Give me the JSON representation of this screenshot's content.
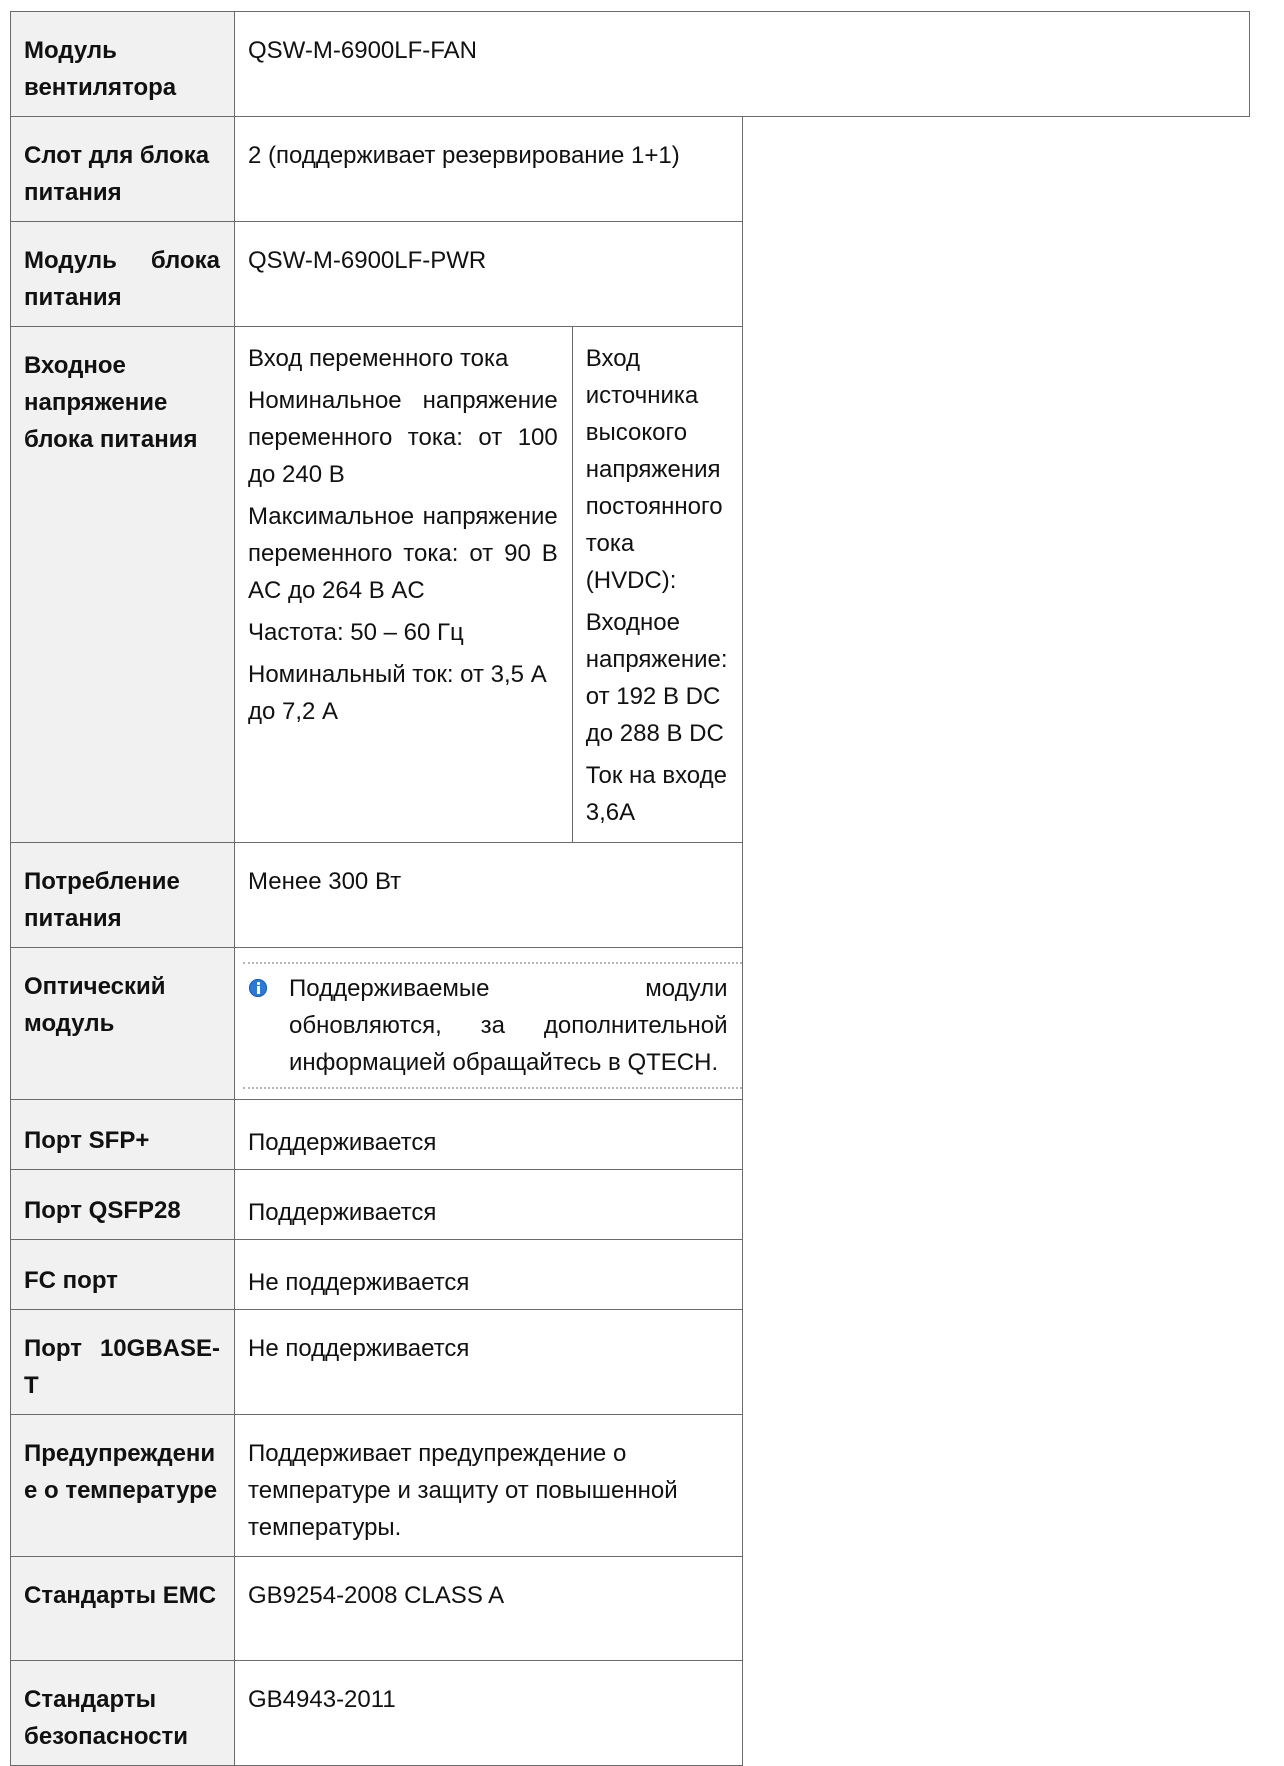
{
  "rows": [
    {
      "label": "Модуль вентилятора",
      "value": "QSW-M-6900LF-FAN"
    },
    {
      "label": "Слот для блока питания",
      "value": "2 (поддерживает резервирование 1+1)"
    },
    {
      "label": "Модуль блока питания",
      "value": "QSW-M-6900LF-PWR"
    },
    {
      "label": "Входное напряжение блока питания",
      "ac": [
        "Вход переменного тока",
        "Номинальное напряжение переменного тока: от 100 до 240 В",
        "Максимальное напряжение переменного тока: от 90 В AC до 264 В AC",
        "Частота: 50 – 60 Гц",
        "Номинальный ток: от 3,5 А до 7,2 А"
      ],
      "dc": [
        "Вход источника высокого напряжения постоянного тока (HVDC):",
        "Входное напряжение: от 192 В DC до 288 В DC",
        "Ток на входе 3,6А"
      ]
    },
    {
      "label": "Потребление питания",
      "value": "Менее 300 Вт"
    },
    {
      "label": "Оптический модуль",
      "note": "Поддерживаемые модули обновляются, за дополнительной информацией обращайтесь в QTECH.",
      "icon": "info-icon"
    },
    {
      "label": "Порт SFP+",
      "value": "Поддерживается"
    },
    {
      "label": "Порт QSFP28",
      "value": "Поддерживается"
    },
    {
      "label": "FC порт",
      "value": "Не поддерживается"
    },
    {
      "label": "Порт 10GBASE-T",
      "value": "Не поддерживается"
    },
    {
      "label": "Предупреждение о температуре",
      "value": "Поддерживает предупреждение о температуре и защиту от повышенной температуры."
    },
    {
      "label": "Стандарты EMC",
      "value": "GB9254-2008 CLASS A"
    },
    {
      "label": "Стандарты безопасности",
      "value": "GB4943-2011"
    }
  ]
}
